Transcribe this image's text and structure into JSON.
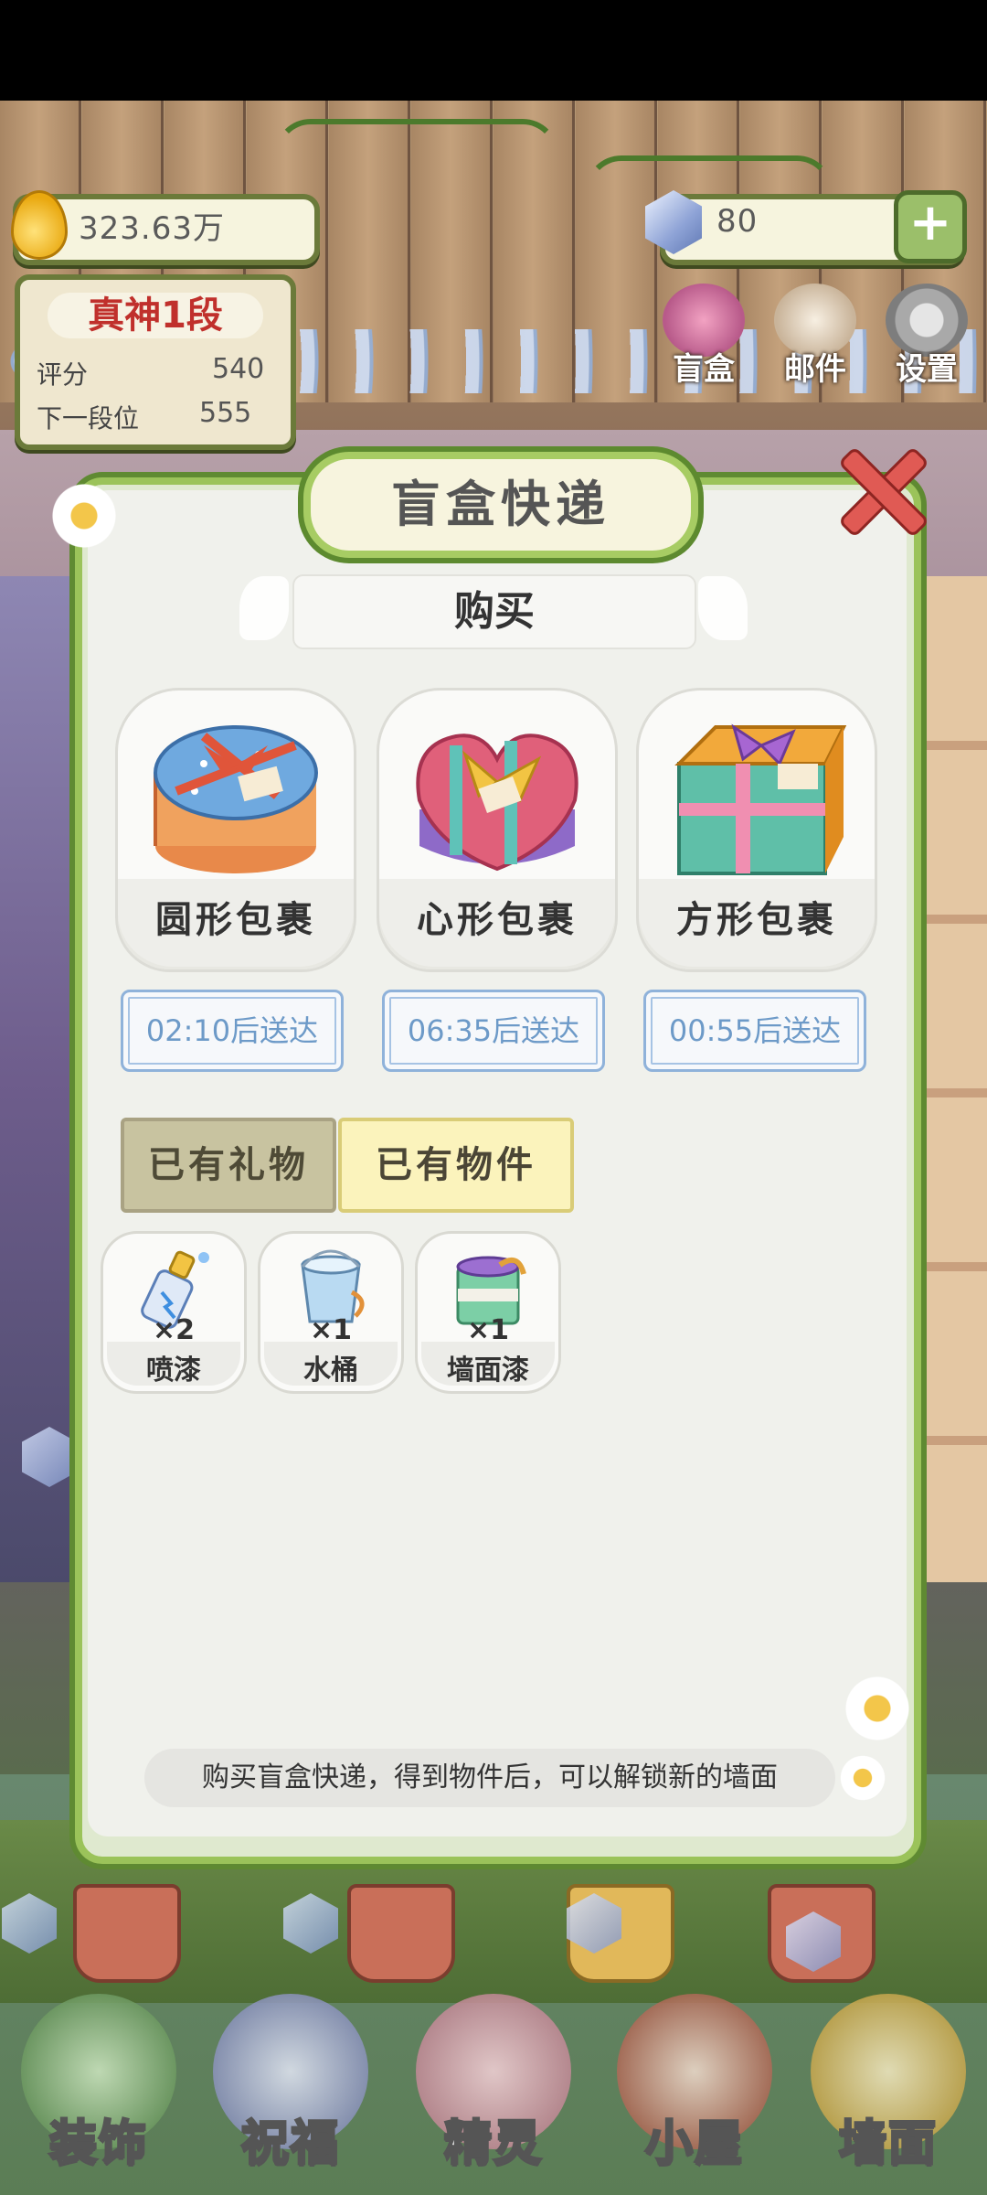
{
  "hud": {
    "currency": "323.63万",
    "gems": "80",
    "plus": "+",
    "rank": {
      "title": "真神1段",
      "score_label": "评分",
      "score_value": "540",
      "next_label": "下一段位",
      "next_value": "555"
    },
    "buttons": [
      {
        "label": "盲盒",
        "icon": "mystery-box-icon"
      },
      {
        "label": "邮件",
        "icon": "mail-icon"
      },
      {
        "label": "设置",
        "icon": "gear-icon"
      }
    ]
  },
  "modal": {
    "title": "盲盒快递",
    "buy_tab": "购买",
    "packages": [
      {
        "name": "圆形包裹",
        "timer": "02:10后送达",
        "icon": "round-gift-box-icon",
        "color": "#6fa9df"
      },
      {
        "name": "心形包裹",
        "timer": "06:35后送达",
        "icon": "heart-gift-box-icon",
        "color": "#e0607a"
      },
      {
        "name": "方形包裹",
        "timer": "00:55后送达",
        "icon": "square-gift-box-icon",
        "color": "#f2a93b"
      }
    ],
    "tabs": {
      "gifts": "已有礼物",
      "items": "已有物件",
      "selected": "items"
    },
    "items": [
      {
        "qty": "×2",
        "name": "喷漆",
        "icon": "spray-paint-icon"
      },
      {
        "qty": "×1",
        "name": "水桶",
        "icon": "bucket-icon"
      },
      {
        "qty": "×1",
        "name": "墙面漆",
        "icon": "wall-paint-icon"
      }
    ],
    "hint": "购买盲盒快递，得到物件后，可以解锁新的墙面"
  },
  "nav": [
    {
      "label": "装饰",
      "icon": "decoration-plant-icon"
    },
    {
      "label": "祝福",
      "icon": "blessing-icon"
    },
    {
      "label": "精灵",
      "icon": "spirit-icon"
    },
    {
      "label": "小屋",
      "icon": "house-icon"
    },
    {
      "label": "墙面",
      "icon": "wall-bell-icon"
    }
  ]
}
